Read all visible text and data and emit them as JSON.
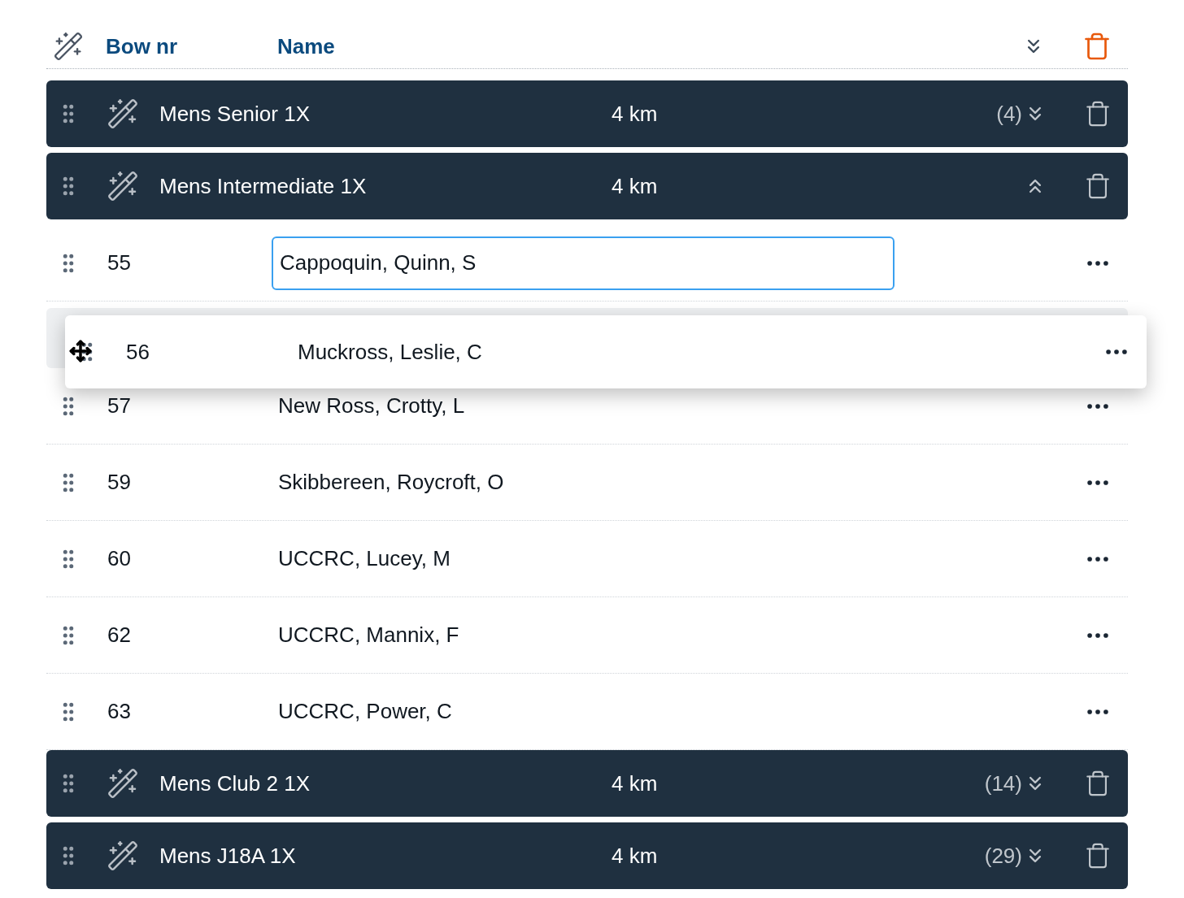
{
  "header": {
    "columns": [
      "Bow nr",
      "Name"
    ]
  },
  "items": [
    {
      "kind": "group",
      "name": "Mens Senior 1X",
      "distance": "4 km",
      "count": "(4)",
      "expanded": false
    },
    {
      "kind": "group",
      "name": "Mens Intermediate 1X",
      "distance": "4 km",
      "expanded": true
    },
    {
      "kind": "entry",
      "bow": "55",
      "name": "Cappoquin, Quinn, S",
      "editing": true
    },
    {
      "kind": "placeholder"
    },
    {
      "kind": "entry",
      "bow": "57",
      "name": "New Ross, Crotty, L",
      "editing": false
    },
    {
      "kind": "entry",
      "bow": "59",
      "name": "Skibbereen, Roycroft, O",
      "editing": false
    },
    {
      "kind": "entry",
      "bow": "60",
      "name": "UCCRC, Lucey, M",
      "editing": false
    },
    {
      "kind": "entry",
      "bow": "62",
      "name": "UCCRC, Mannix, F",
      "editing": false
    },
    {
      "kind": "entry",
      "bow": "63",
      "name": "UCCRC, Power, C",
      "editing": false
    },
    {
      "kind": "group",
      "name": "Mens Club 2 1X",
      "distance": "4 km",
      "count": "(14)",
      "expanded": false
    },
    {
      "kind": "group",
      "name": "Mens J18A 1X",
      "distance": "4 km",
      "count": "(29)",
      "expanded": false
    }
  ],
  "dragged": {
    "bow": "56",
    "name": "Muckross, Leslie, C"
  }
}
